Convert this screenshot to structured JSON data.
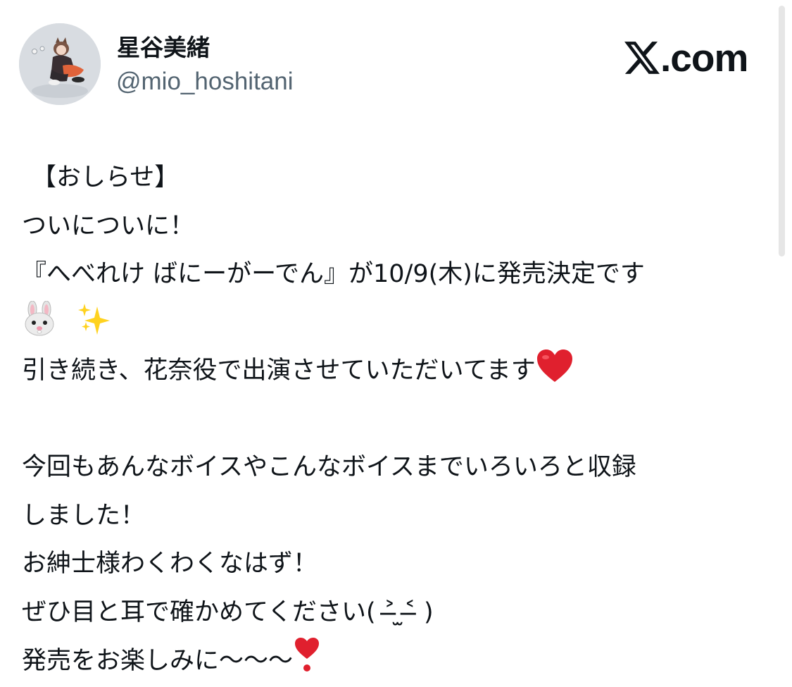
{
  "header": {
    "display_name": "星谷美緒",
    "handle": "@mio_hoshitani",
    "brand_domain": ".com"
  },
  "tweet": {
    "lines": [
      "【おしらせ】",
      "ついについに！",
      "『へべれけ ばにーがーでん』が10/9(木)に発売決定です",
      "",
      "引き続き、花奈役で出演させていただいてます",
      "",
      "今回もあんなボイスやこんなボイスまでいろいろと収録",
      "しました！",
      "お紳士様わくわくなはず！",
      "ぜひ目と耳で確かめてください( ˃̶ ̫˂̶ )",
      "発売をお楽しみに〜〜〜"
    ],
    "line_emojis": {
      "3": [
        "rabbit-face-emoji",
        "sparkles-emoji"
      ],
      "4": [
        "red-heart-emoji"
      ],
      "10": [
        "heart-exclamation-emoji"
      ]
    }
  },
  "icons": {
    "brand_logo": "x-logo-icon",
    "avatar": "profile-photo"
  },
  "colors": {
    "text_primary": "#0f1419",
    "text_secondary": "#536471",
    "heart": "#e0202e",
    "background": "#ffffff"
  }
}
